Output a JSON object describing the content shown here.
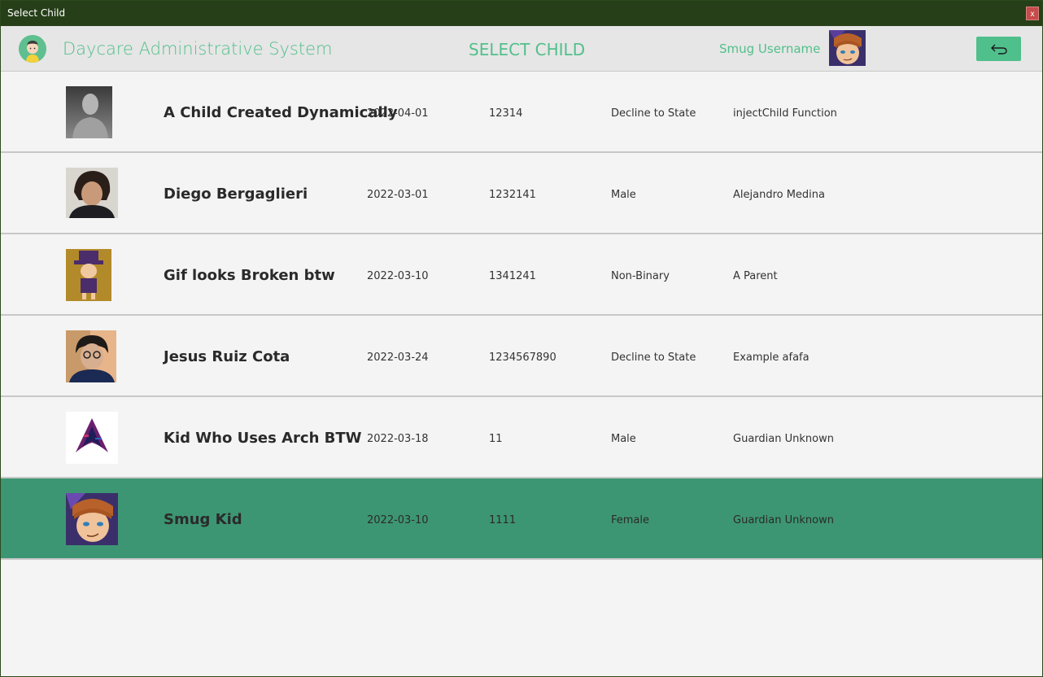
{
  "window": {
    "title": "Select Child",
    "close_label": "x"
  },
  "header": {
    "app_title": "Daycare Administrative System",
    "page_title": "SELECT CHILD",
    "username": "Smug Username",
    "back_icon": "undo-arrow-icon"
  },
  "children": [
    {
      "name": "A Child Created Dynamically",
      "dob": "2022-04-01",
      "id": "12314",
      "gender": "Decline to State",
      "guardian": "injectChild Function",
      "photo": "grayscale-man-photo"
    },
    {
      "name": "Diego Bergaglieri",
      "dob": "2022-03-01",
      "id": "1232141",
      "gender": "Male",
      "guardian": "Alejandro Medina",
      "photo": "webcam-photo"
    },
    {
      "name": "Gif looks Broken btw",
      "dob": "2022-03-10",
      "id": "1341241",
      "gender": "Non-Binary",
      "guardian": "A Parent",
      "photo": "hat-kid-sprite"
    },
    {
      "name": "Jesus Ruiz Cota",
      "dob": "2022-03-24",
      "id": "1234567890",
      "gender": "Decline to State",
      "guardian": "Example afafa",
      "photo": "glasses-photo"
    },
    {
      "name": "Kid Who Uses Arch BTW",
      "dob": "2022-03-18",
      "id": "11",
      "gender": "Male",
      "guardian": "Guardian Unknown",
      "photo": "arch-logo"
    },
    {
      "name": "Smug Kid",
      "dob": "2022-03-10",
      "id": "1111",
      "gender": "Female",
      "guardian": "Guardian Unknown",
      "photo": "smug-anime-avatar"
    }
  ],
  "colors": {
    "titlebar": "#263f19",
    "accent": "#52bf8a",
    "selected_row": "#3d9673",
    "close": "#c64b4b"
  },
  "selected_index": 5
}
